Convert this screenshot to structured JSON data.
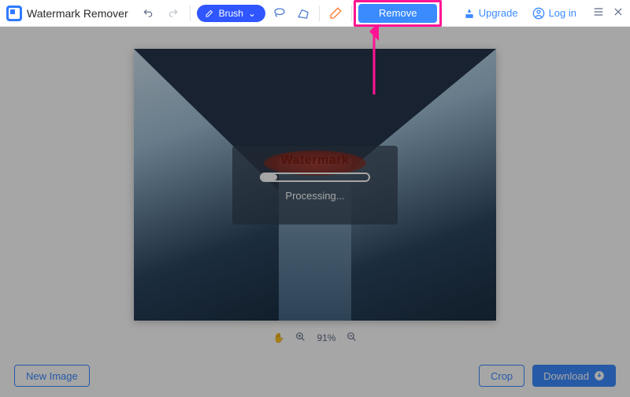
{
  "app": {
    "title": "Watermark Remover"
  },
  "toolbar": {
    "brush_label": "Brush",
    "remove_label": "Remove",
    "upgrade_label": "Upgrade",
    "login_label": "Log in"
  },
  "canvas": {
    "watermark_text": "Watermark",
    "processing_label": "Processing...",
    "progress_pct": 15
  },
  "zoom": {
    "level": "91%"
  },
  "bottom": {
    "new_image": "New Image",
    "crop": "Crop",
    "download": "Download"
  },
  "colors": {
    "primary": "#3b8bff",
    "brush": "#2f56ff",
    "highlight": "#ff1493"
  }
}
